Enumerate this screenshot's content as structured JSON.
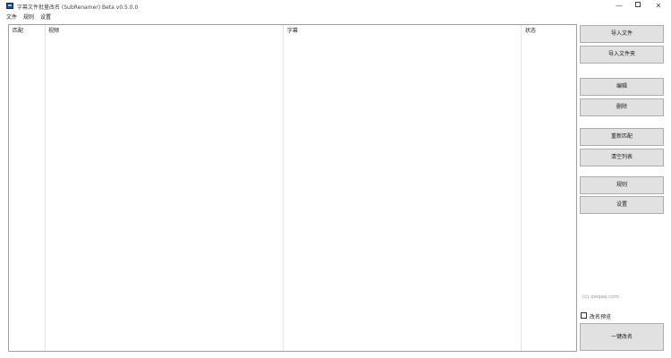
{
  "window": {
    "title": "字幕文件批量改名 (SubRenamer) Beta v0.5.0.0",
    "minimize_glyph": "—",
    "close_glyph": "✕"
  },
  "menu": {
    "file": "文件",
    "rules": "规则",
    "settings": "设置"
  },
  "grid": {
    "columns": [
      "匹配",
      "视频",
      "字幕",
      "状态"
    ]
  },
  "actions": {
    "import_files": "导入文件",
    "import_folder": "导入文件夹",
    "edit": "编辑",
    "delete": "删除",
    "rematch": "重新匹配",
    "clear_list": "清空列表",
    "rules": "规则",
    "settings": "设置",
    "rename_all": "一键改名"
  },
  "footer": {
    "copyright": "(c) qwqaq.com",
    "preview_label": "改名预览",
    "preview_checked": false
  },
  "icons": {
    "app": "app-icon",
    "minimize": "minimize-icon",
    "maximize": "maximize-icon",
    "close": "close-icon"
  }
}
